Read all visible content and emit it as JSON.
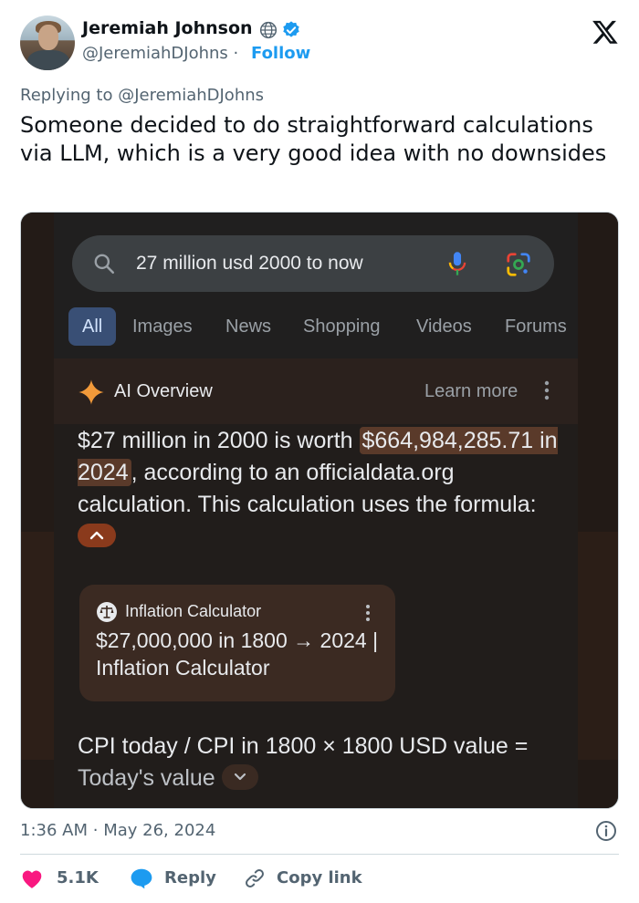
{
  "author": {
    "name": "Jeremiah Johnson",
    "handle": "@JeremiahDJohns",
    "separator": "·",
    "follow_label": "Follow"
  },
  "replying_to": "Replying to @JeremiahDJohns",
  "tweet_text": "Someone decided to do straightforward calculations via LLM, which is a very good idea with no downsides",
  "screenshot": {
    "search_query": "27 million usd 2000 to now",
    "tabs": [
      "All",
      "Images",
      "News",
      "Shopping",
      "Videos",
      "Forums"
    ],
    "active_tab": "All",
    "ai_overview": {
      "title": "AI Overview",
      "learn_more": "Learn more",
      "text_before": "$27 million in 2000 is worth ",
      "highlight": "$664,984,285.71 in 2024",
      "text_after": ", according to an officialdata.org calculation. This calculation uses the formula:",
      "source_card": {
        "source": "Inflation Calculator",
        "title": "$27,000,000 in 1800 → 2024 | Inflation Calculator"
      },
      "formula_line": "CPI today / CPI in 1800 × 1800 USD value =",
      "formula_result": "Today's value"
    }
  },
  "footer": {
    "time": "1:36 AM",
    "separator": "·",
    "date": "May 26, 2024",
    "likes": "5.1K",
    "reply_label": "Reply",
    "copy_link_label": "Copy link"
  },
  "colors": {
    "accent_blue": "#1d9bf0",
    "like_red": "#f91880",
    "ai_highlight": "#5a3a2a"
  }
}
